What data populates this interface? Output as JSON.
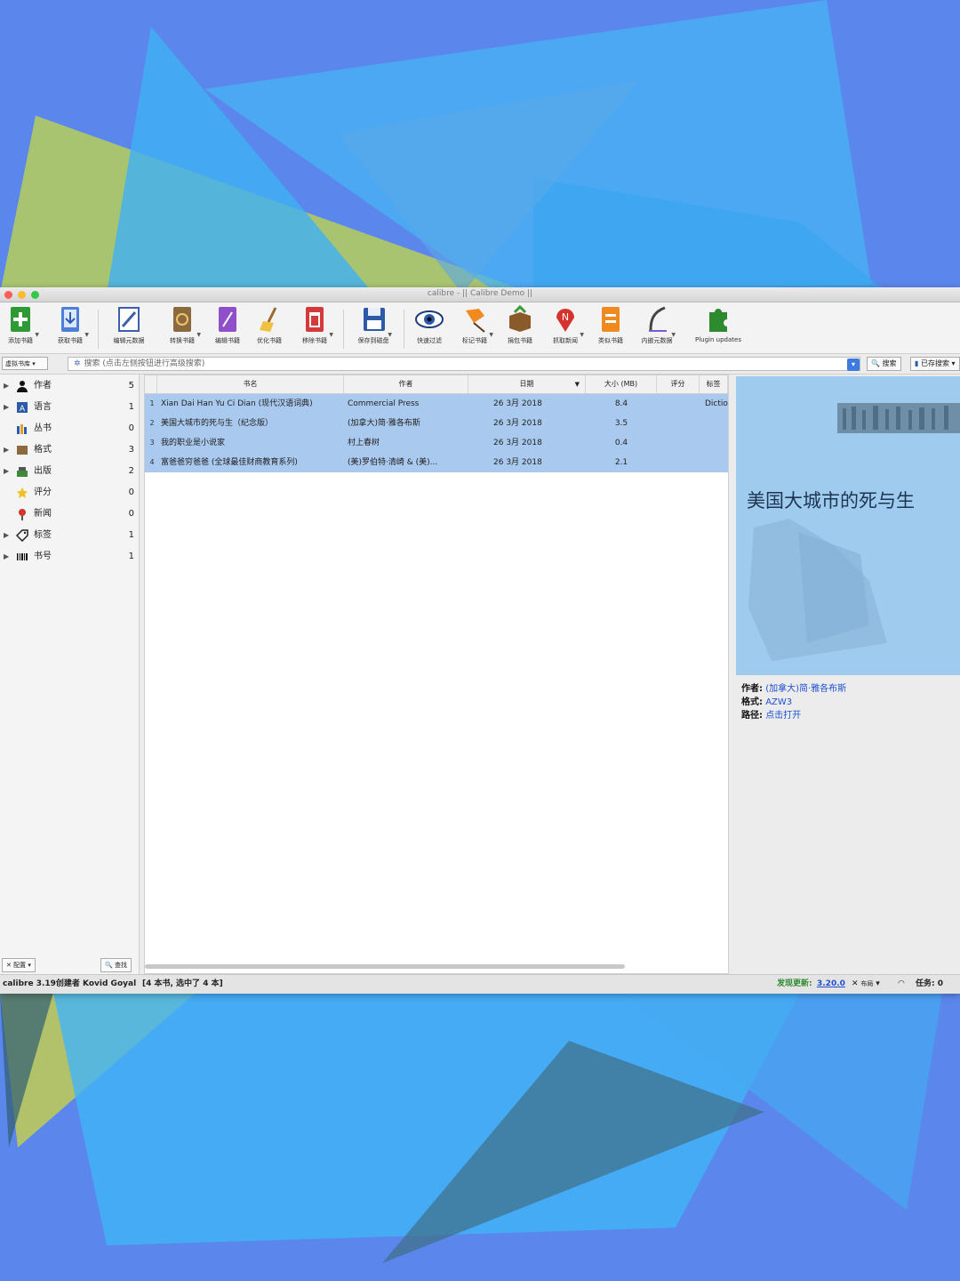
{
  "window": {
    "title": "calibre - || Calibre Demo ||"
  },
  "toolbar": {
    "items": [
      {
        "label": "添加书籍",
        "icon": "add-book-icon"
      },
      {
        "label": "获取书籍",
        "icon": "download-icon"
      },
      {
        "label": "编辑元数据",
        "icon": "edit-metadata-icon"
      },
      {
        "label": "转换书籍",
        "icon": "convert-icon"
      },
      {
        "label": "编辑书籍",
        "icon": "edit-book-icon"
      },
      {
        "label": "优化书籍",
        "icon": "broom-icon"
      },
      {
        "label": "移除书籍",
        "icon": "trash-icon"
      },
      {
        "label": "保存到磁盘",
        "icon": "save-icon"
      },
      {
        "label": "快速过滤",
        "icon": "eye-icon"
      },
      {
        "label": "标记书籍",
        "icon": "pin-icon"
      },
      {
        "label": "捐包书籍",
        "icon": "box-icon"
      },
      {
        "label": "抓取新闻",
        "icon": "news-icon"
      },
      {
        "label": "类似书籍",
        "icon": "similar-icon"
      },
      {
        "label": "内嵌元数据",
        "icon": "quill-icon"
      },
      {
        "label": "Plugin updates",
        "icon": "puzzle-icon"
      }
    ]
  },
  "search": {
    "virtual_library": "虚拟书库",
    "placeholder": "搜索 (点击左侧按钮进行高级搜索)",
    "search_button": "搜索",
    "saved_button": "已存搜索"
  },
  "sidebar": {
    "categories": [
      {
        "name": "作者",
        "count": "5",
        "icon": "person-icon"
      },
      {
        "name": "语言",
        "count": "1",
        "icon": "language-icon"
      },
      {
        "name": "丛书",
        "count": "0",
        "icon": "series-icon"
      },
      {
        "name": "格式",
        "count": "3",
        "icon": "format-icon"
      },
      {
        "name": "出版",
        "count": "2",
        "icon": "publisher-icon"
      },
      {
        "name": "评分",
        "count": "0",
        "icon": "star-icon"
      },
      {
        "name": "新闻",
        "count": "0",
        "icon": "news-pin-icon"
      },
      {
        "name": "标签",
        "count": "1",
        "icon": "tag-icon"
      },
      {
        "name": "书号",
        "count": "1",
        "icon": "barcode-icon"
      }
    ],
    "configure": "配置",
    "find": "查找"
  },
  "books": {
    "columns": [
      "书名",
      "作者",
      "日期",
      "大小 (MB)",
      "评分",
      "标签"
    ],
    "rows": [
      {
        "n": "1",
        "title": "Xian Dai Han Yu Ci Dian (现代汉语词典)",
        "author": "Commercial Press",
        "date": "26 3月 2018",
        "size": "8.4",
        "rating": "",
        "tags": "Dictio"
      },
      {
        "n": "2",
        "title": "美国大城市的死与生（纪念版）",
        "author": "(加拿大)简·雅各布斯",
        "date": "26 3月 2018",
        "size": "3.5",
        "rating": "",
        "tags": ""
      },
      {
        "n": "3",
        "title": "我的职业是小说家",
        "author": "村上春树",
        "date": "26 3月 2018",
        "size": "0.4",
        "rating": "",
        "tags": ""
      },
      {
        "n": "4",
        "title": "富爸爸穷爸爸 (全球最佳财商教育系列)",
        "author": "(美)罗伯特·清崎 & (美)...",
        "date": "26 3月 2018",
        "size": "2.1",
        "rating": "",
        "tags": ""
      }
    ]
  },
  "preview": {
    "cover_title": "美国大城市的死与生",
    "author_label": "作者:",
    "author": "(加拿大)简·雅各布斯",
    "format_label": "格式:",
    "format": "AZW3",
    "path_label": "路径:",
    "path": "点击打开"
  },
  "status": {
    "left": "calibre 3.19创建者 Kovid Goyal",
    "count": "[4 本书, 选中了 4 本]",
    "update_label": "发现更新:",
    "update_version": "3.20.0",
    "layout": "布局",
    "jobs": "任务: 0"
  },
  "colors": {
    "background": "#5b86ec",
    "selection": "#a9c9ef",
    "link": "#1d4fd6"
  }
}
